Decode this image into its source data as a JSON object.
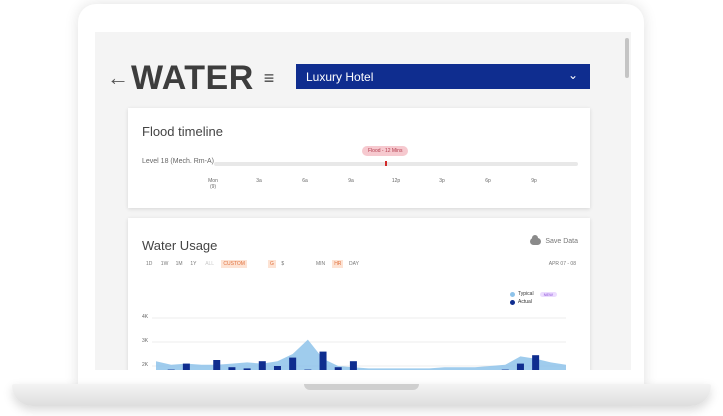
{
  "header": {
    "back_icon": "arrow-left-icon",
    "title": "WATER",
    "menu_icon": "hamburger-menu-icon",
    "property_select": "Luxury Hotel",
    "select_icon": "chevron-down-icon"
  },
  "flood": {
    "title": "Flood timeline",
    "level_label": "Level 18 (Mech. Rm-A)",
    "badge": "Flood - 12 Mins",
    "ticks": [
      "Mon\n(9)",
      "3a",
      "6a",
      "9a",
      "12p",
      "3p",
      "6p",
      "9p"
    ]
  },
  "usage": {
    "title": "Water Usage",
    "save_label": "Save Data",
    "range_buttons": [
      "1D",
      "1W",
      "1M",
      "1Y",
      "ALL",
      "CUSTOM"
    ],
    "active_range": "CUSTOM",
    "unit_buttons": [
      "G",
      "$"
    ],
    "active_unit": "G",
    "resolution_buttons": [
      "MIN",
      "HR",
      "DAY"
    ],
    "active_resolution": "HR",
    "date_range": "APR 07 - 08",
    "legend": {
      "typical": "Typical",
      "actual": "Actual",
      "new_badge": "NEW"
    }
  },
  "colors": {
    "select_bg": "#0f2d8f",
    "typical": "#8ec3ea",
    "actual": "#0f2d8f",
    "accent": "#e0703c"
  },
  "chart_data": {
    "type": "bar",
    "y_ticks": [
      "4K",
      "3K",
      "2K"
    ],
    "series": [
      {
        "name": "Typical",
        "type": "area",
        "x": [
          0,
          1,
          2,
          3,
          4,
          5,
          6,
          7,
          8,
          9,
          10,
          11,
          12,
          13,
          14,
          15,
          16,
          17,
          18,
          19,
          20,
          21,
          22,
          23,
          24,
          25,
          26,
          27
        ],
        "values": [
          2200,
          2050,
          2100,
          2050,
          2050,
          2100,
          2150,
          2100,
          2200,
          2500,
          3100,
          2300,
          2000,
          1950,
          1900,
          1900,
          1900,
          1900,
          1900,
          1950,
          1950,
          1950,
          2000,
          2050,
          2400,
          2300,
          2150,
          2050
        ]
      },
      {
        "name": "Actual",
        "type": "bar",
        "x": [
          0,
          1,
          2,
          3,
          4,
          5,
          6,
          7,
          8,
          9,
          10,
          11,
          12,
          13,
          14,
          15,
          16,
          17,
          18,
          19,
          20,
          21,
          22,
          23,
          24,
          25,
          26,
          27
        ],
        "values": [
          0,
          1850,
          2100,
          0,
          2250,
          1950,
          1900,
          2200,
          2000,
          2350,
          1850,
          2600,
          1950,
          2200,
          1750,
          0,
          0,
          0,
          0,
          0,
          0,
          0,
          0,
          1850,
          2100,
          2450,
          1750,
          0
        ]
      }
    ],
    "ylim": [
      1500,
      4000
    ],
    "grid": true,
    "legend_placement": "top-right"
  }
}
